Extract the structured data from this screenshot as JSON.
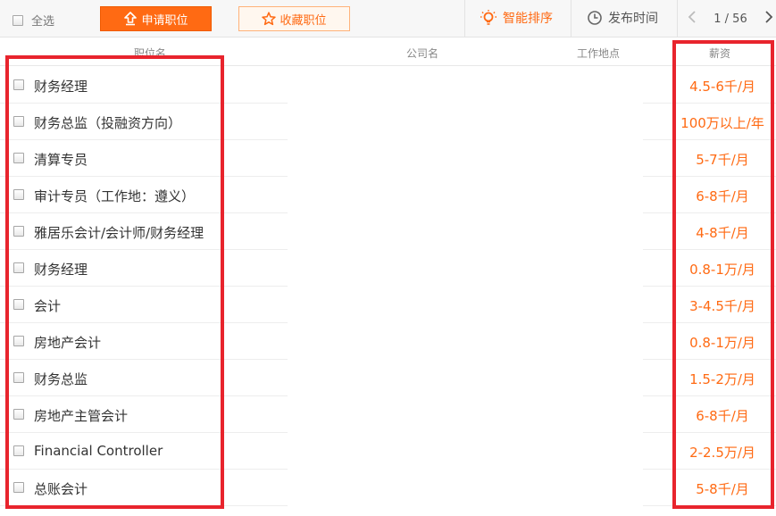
{
  "toolbar": {
    "select_all": "全选",
    "apply_label": "申请职位",
    "favorite_label": "收藏职位",
    "smart_sort_label": "智能排序",
    "publish_time_label": "发布时间",
    "page_indicator": "1 / 56",
    "accent_color": "#ff6a13"
  },
  "columns": {
    "position": "职位名",
    "company": "公司名",
    "location": "工作地点",
    "salary": "薪资"
  },
  "jobs": [
    {
      "title": "财务经理",
      "salary": "4.5-6千/月"
    },
    {
      "title": "财务总监（投融资方向）",
      "salary": "100万以上/年"
    },
    {
      "title": "清算专员",
      "salary": "5-7千/月"
    },
    {
      "title": "审计专员（工作地：遵义）",
      "salary": "6-8千/月"
    },
    {
      "title": "雅居乐会计/会计师/财务经理",
      "salary": "4-8千/月"
    },
    {
      "title": "财务经理",
      "salary": "0.8-1万/月"
    },
    {
      "title": "会计",
      "salary": "3-4.5千/月"
    },
    {
      "title": "房地产会计",
      "salary": "0.8-1万/月"
    },
    {
      "title": "财务总监",
      "salary": "1.5-2万/月"
    },
    {
      "title": "房地产主管会计",
      "salary": "6-8千/月"
    },
    {
      "title": "Financial Controller",
      "salary": "2-2.5万/月"
    },
    {
      "title": "总账会计",
      "salary": "5-8千/月"
    }
  ],
  "annotation_color": "#e8242d"
}
